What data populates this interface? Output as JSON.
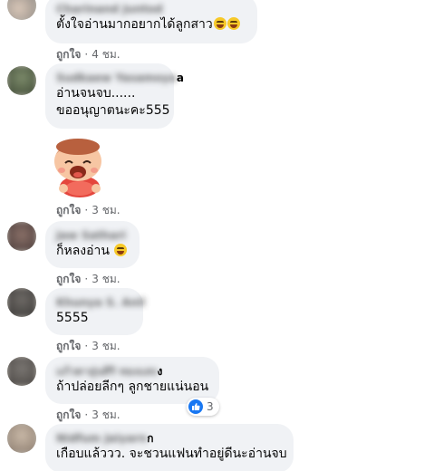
{
  "comments": [
    {
      "name": "Charinand Juntod",
      "name_suffix": "",
      "lines": [
        "ตั้งใจอ่านมากอยากได้ลูกสาว"
      ],
      "emoji_count": 2,
      "like_label": "ถูกใจ",
      "time": "4 ชม."
    },
    {
      "name": "Sudkaew Yasamoya",
      "name_suffix": "a",
      "lines": [
        "อ่านจนจบ......",
        "ขออนุญาตนะคะ555"
      ],
      "like_label": "ถูกใจ",
      "time": "3 ชม.",
      "sticker": "laughing-girl-sticker"
    },
    {
      "name": "Jaw Sathari",
      "name_suffix": "",
      "lines": [
        "ก็หลงอ่าน"
      ],
      "emoji_count": 1,
      "like_label": "ถูกใจ",
      "time": "3 ชม."
    },
    {
      "name": "Khunya S. Anil",
      "name_suffix": "",
      "lines": [
        "5555"
      ],
      "like_label": "ถูกใจ",
      "time": "3 ชม."
    },
    {
      "name": "แก้วตาอุ่นสิริ ทองแสง",
      "name_suffix": "ง",
      "lines": [
        "ถ้าปล่อยลีกๆ ลูกชายแน่นอน"
      ],
      "like_label": "ถูกใจ",
      "time": "3 ชม.",
      "reaction_count": "3"
    },
    {
      "name": "Nidfum Jaiyarn",
      "name_suffix": "ก",
      "lines": [
        "เกือบแล้ววว. จะชวนแฟนทำอยู่ดีนะอ่านจบ"
      ]
    }
  ],
  "dot": "·",
  "colors": {
    "bubble": "#f0f2f5",
    "meta": "#65676b",
    "like_blue": "#1877f2"
  }
}
